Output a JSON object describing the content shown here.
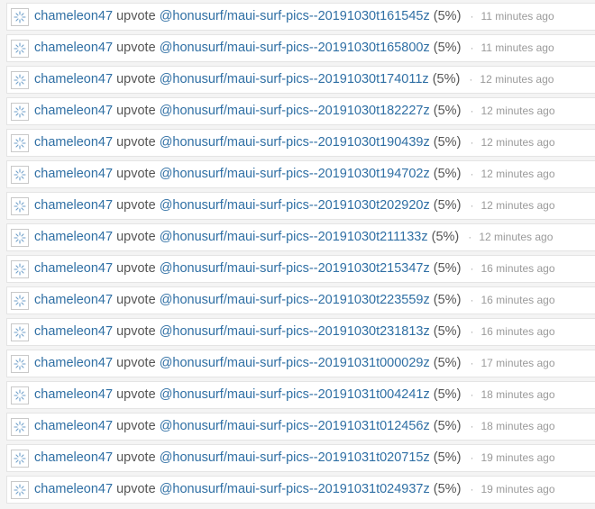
{
  "feed": {
    "rows": [
      {
        "account": "chameleon47",
        "action": "upvote",
        "permlink": "@honusurf/maui-surf-pics--20191030t161545z",
        "weight": "(5%)",
        "separator": "·",
        "time": "11 minutes ago"
      },
      {
        "account": "chameleon47",
        "action": "upvote",
        "permlink": "@honusurf/maui-surf-pics--20191030t165800z",
        "weight": "(5%)",
        "separator": "·",
        "time": "11 minutes ago"
      },
      {
        "account": "chameleon47",
        "action": "upvote",
        "permlink": "@honusurf/maui-surf-pics--20191030t174011z",
        "weight": "(5%)",
        "separator": "·",
        "time": "12 minutes ago"
      },
      {
        "account": "chameleon47",
        "action": "upvote",
        "permlink": "@honusurf/maui-surf-pics--20191030t182227z",
        "weight": "(5%)",
        "separator": "·",
        "time": "12 minutes ago"
      },
      {
        "account": "chameleon47",
        "action": "upvote",
        "permlink": "@honusurf/maui-surf-pics--20191030t190439z",
        "weight": "(5%)",
        "separator": "·",
        "time": "12 minutes ago"
      },
      {
        "account": "chameleon47",
        "action": "upvote",
        "permlink": "@honusurf/maui-surf-pics--20191030t194702z",
        "weight": "(5%)",
        "separator": "·",
        "time": "12 minutes ago"
      },
      {
        "account": "chameleon47",
        "action": "upvote",
        "permlink": "@honusurf/maui-surf-pics--20191030t202920z",
        "weight": "(5%)",
        "separator": "·",
        "time": "12 minutes ago"
      },
      {
        "account": "chameleon47",
        "action": "upvote",
        "permlink": "@honusurf/maui-surf-pics--20191030t211133z",
        "weight": "(5%)",
        "separator": "·",
        "time": "12 minutes ago"
      },
      {
        "account": "chameleon47",
        "action": "upvote",
        "permlink": "@honusurf/maui-surf-pics--20191030t215347z",
        "weight": "(5%)",
        "separator": "·",
        "time": "16 minutes ago"
      },
      {
        "account": "chameleon47",
        "action": "upvote",
        "permlink": "@honusurf/maui-surf-pics--20191030t223559z",
        "weight": "(5%)",
        "separator": "·",
        "time": "16 minutes ago"
      },
      {
        "account": "chameleon47",
        "action": "upvote",
        "permlink": "@honusurf/maui-surf-pics--20191030t231813z",
        "weight": "(5%)",
        "separator": "·",
        "time": "16 minutes ago"
      },
      {
        "account": "chameleon47",
        "action": "upvote",
        "permlink": "@honusurf/maui-surf-pics--20191031t000029z",
        "weight": "(5%)",
        "separator": "·",
        "time": "17 minutes ago"
      },
      {
        "account": "chameleon47",
        "action": "upvote",
        "permlink": "@honusurf/maui-surf-pics--20191031t004241z",
        "weight": "(5%)",
        "separator": "·",
        "time": "18 minutes ago"
      },
      {
        "account": "chameleon47",
        "action": "upvote",
        "permlink": "@honusurf/maui-surf-pics--20191031t012456z",
        "weight": "(5%)",
        "separator": "·",
        "time": "18 minutes ago"
      },
      {
        "account": "chameleon47",
        "action": "upvote",
        "permlink": "@honusurf/maui-surf-pics--20191031t020715z",
        "weight": "(5%)",
        "separator": "·",
        "time": "19 minutes ago"
      },
      {
        "account": "chameleon47",
        "action": "upvote",
        "permlink": "@honusurf/maui-surf-pics--20191031t024937z",
        "weight": "(5%)",
        "separator": "·",
        "time": "19 minutes ago"
      }
    ]
  },
  "icons": {
    "avatar": "avatar-icon"
  },
  "colors": {
    "link": "#2f6fa4",
    "text": "#555555",
    "muted": "#9a9a9a",
    "row_bg": "#ffffff",
    "page_bg": "#f4f4f4"
  }
}
